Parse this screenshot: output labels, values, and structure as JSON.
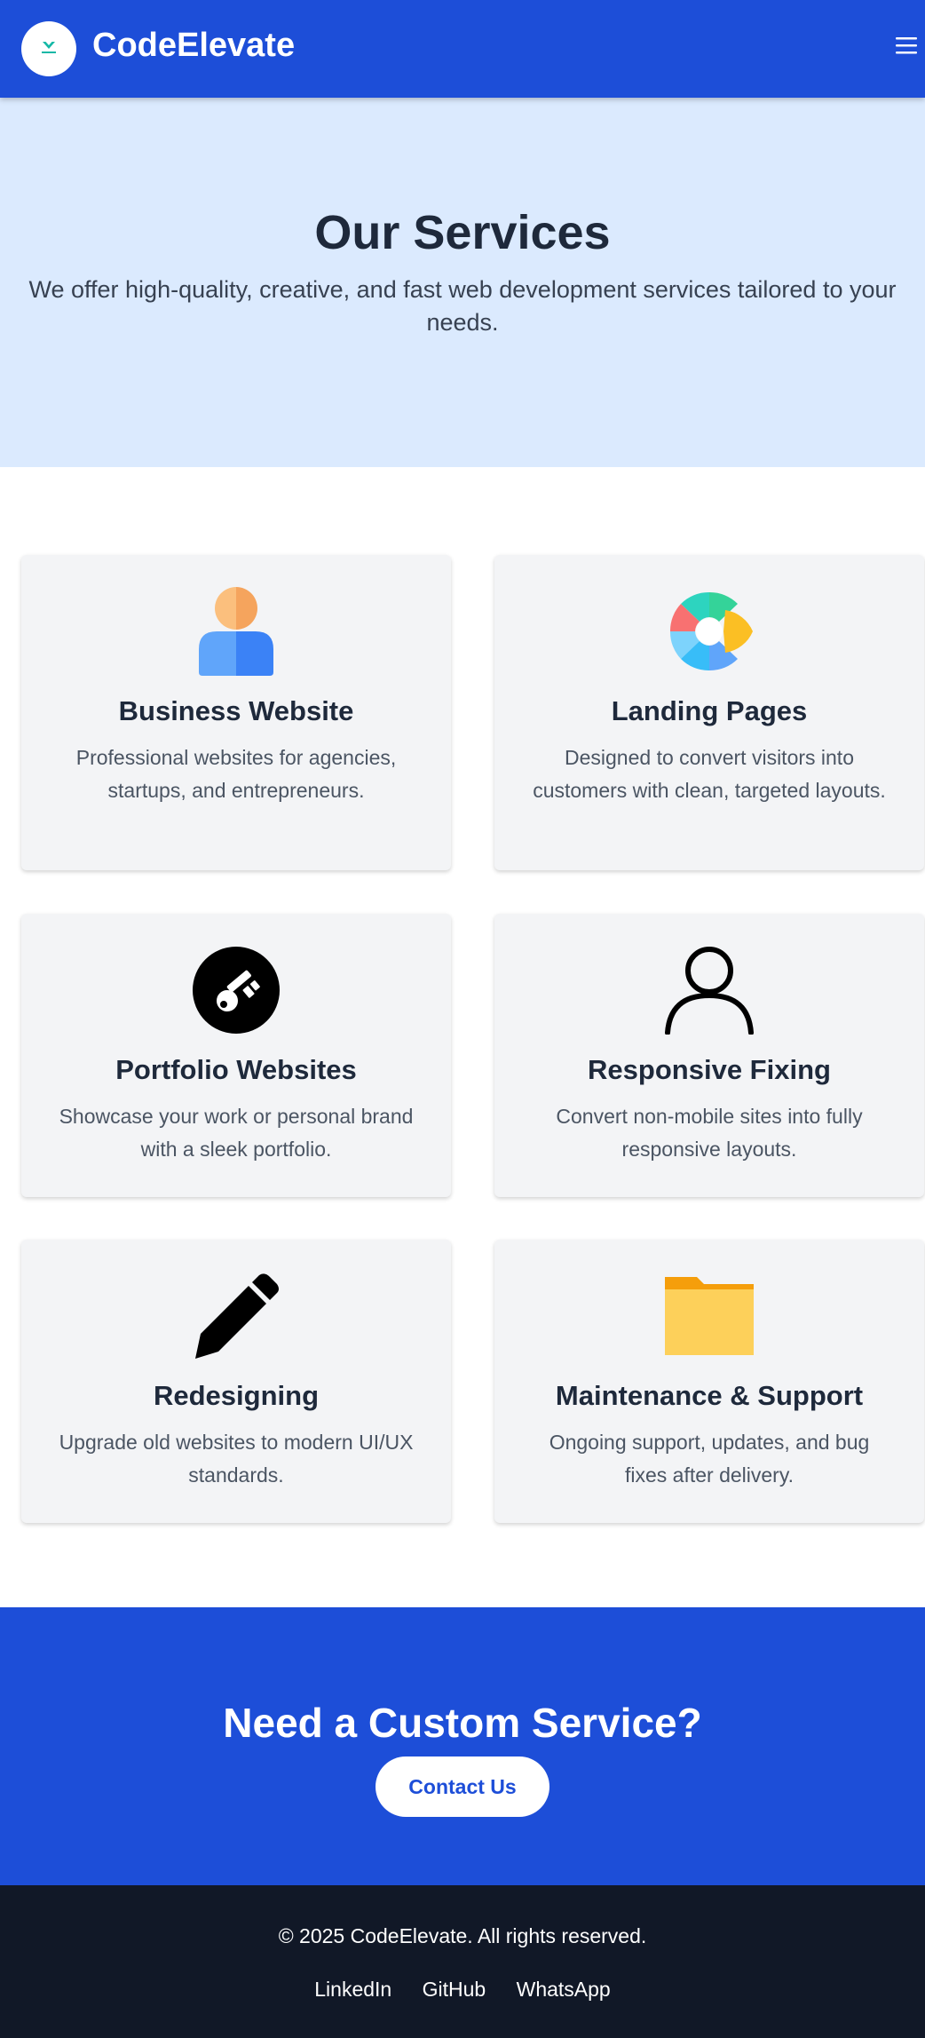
{
  "navbar": {
    "brand": "CodeElevate",
    "logo_icon": "codeelevate-logo",
    "menu_icon": "hamburger-menu-icon"
  },
  "hero": {
    "title": "Our Services",
    "subtitle": "We offer high-quality, creative, and fast web development services tailored to your needs."
  },
  "services": [
    {
      "title": "Business Website",
      "description": "Professional websites for agencies, startups, and entrepreneurs.",
      "icon": "user-avatar-icon"
    },
    {
      "title": "Landing Pages",
      "description": "Designed to convert visitors into customers with clean, targeted layouts.",
      "icon": "donut-chart-icon"
    },
    {
      "title": "Portfolio Websites",
      "description": "Showcase your work or personal brand with a sleek portfolio.",
      "icon": "key-icon"
    },
    {
      "title": "Responsive Fixing",
      "description": "Convert non-mobile sites into fully responsive layouts.",
      "icon": "user-outline-icon"
    },
    {
      "title": "Redesigning",
      "description": "Upgrade old websites to modern UI/UX standards.",
      "icon": "pencil-icon"
    },
    {
      "title": "Maintenance & Support",
      "description": "Ongoing support, updates, and bug fixes after delivery.",
      "icon": "folder-icon"
    }
  ],
  "cta": {
    "title": "Need a Custom Service?",
    "button_label": "Contact Us"
  },
  "footer": {
    "copyright": "© 2025 CodeElevate. All rights reserved.",
    "links": [
      "LinkedIn",
      "GitHub",
      "WhatsApp"
    ]
  },
  "colors": {
    "primary": "#1d4ed8",
    "hero_bg": "#dbeafe",
    "card_bg": "#f3f4f6",
    "footer_bg": "#111827"
  }
}
